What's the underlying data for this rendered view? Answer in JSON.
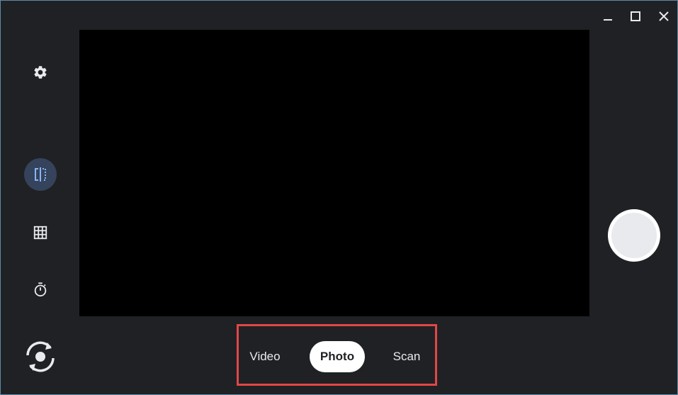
{
  "window": {
    "controls": [
      {
        "name": "minimize-icon"
      },
      {
        "name": "maximize-icon"
      },
      {
        "name": "close-icon"
      }
    ]
  },
  "toolbar": {
    "items": [
      {
        "name": "settings-icon",
        "active": false
      },
      {
        "name": "mirror-icon",
        "active": true
      },
      {
        "name": "grid-icon",
        "active": false
      },
      {
        "name": "timer-icon",
        "active": false
      },
      {
        "name": "switch-camera-icon",
        "active": false
      }
    ]
  },
  "modes": {
    "items": [
      {
        "label": "Video",
        "selected": false
      },
      {
        "label": "Photo",
        "selected": true
      },
      {
        "label": "Scan",
        "selected": false
      }
    ]
  },
  "colors": {
    "background": "#202124",
    "accent_active": "#35435c",
    "accent_icon": "#8ab4f8",
    "highlight_border": "#e04747"
  }
}
